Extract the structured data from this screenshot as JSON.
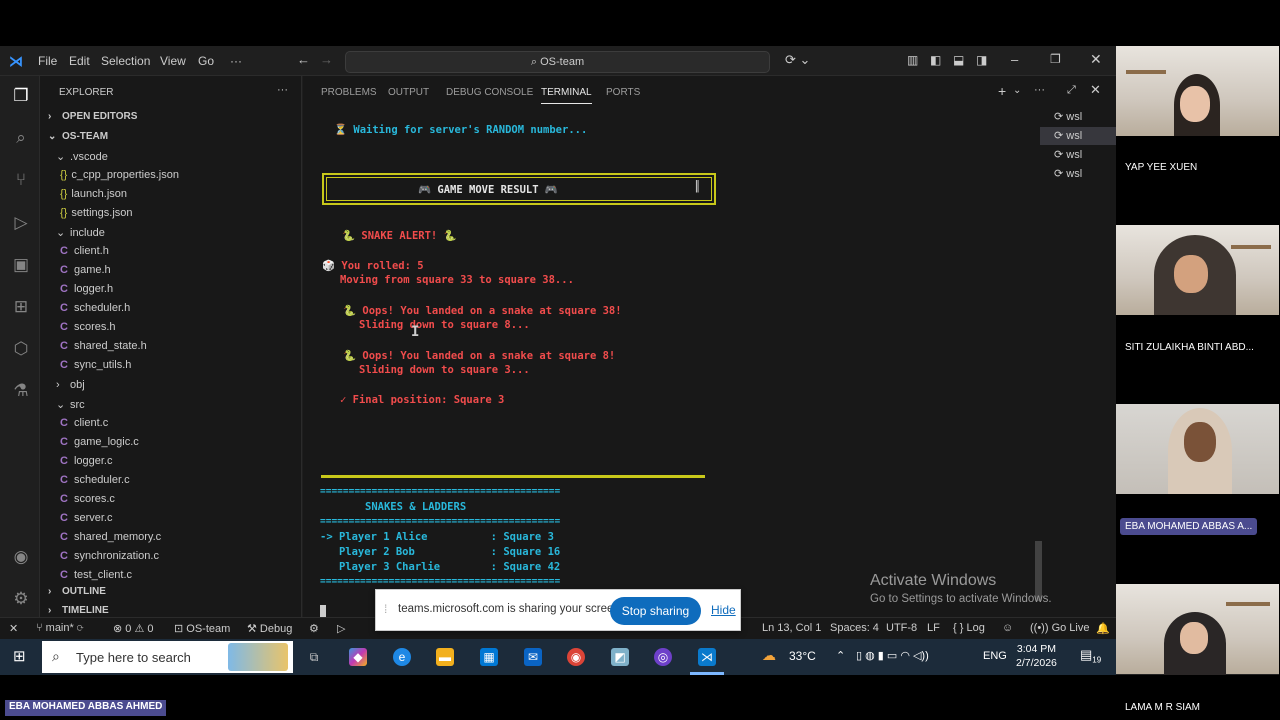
{
  "titlebar": {
    "menus": [
      "File",
      "Edit",
      "Selection",
      "View",
      "Go",
      "···"
    ],
    "search": "OS-team"
  },
  "explorer": {
    "header": "EXPLORER",
    "open_editors": "OPEN EDITORS",
    "root": "OS-TEAM",
    "vscode_folder": ".vscode",
    "vscode_files": [
      "c_cpp_properties.json",
      "launch.json",
      "settings.json"
    ],
    "include_folder": "include",
    "include_files": [
      "client.h",
      "game.h",
      "logger.h",
      "scheduler.h",
      "scores.h",
      "shared_state.h",
      "sync_utils.h"
    ],
    "obj_folder": "obj",
    "src_folder": "src",
    "src_files": [
      "client.c",
      "game_logic.c",
      "logger.c",
      "scheduler.c",
      "scores.c",
      "server.c",
      "shared_memory.c",
      "synchronization.c",
      "test_client.c"
    ],
    "outline": "OUTLINE",
    "timeline": "TIMELINE"
  },
  "panel": {
    "tabs": [
      "PROBLEMS",
      "OUTPUT",
      "DEBUG CONSOLE",
      "TERMINAL",
      "PORTS"
    ],
    "active_tab": "TERMINAL",
    "terminals": [
      "wsl",
      "wsl",
      "wsl",
      "wsl"
    ]
  },
  "terminal": {
    "waiting": "⏳ Waiting for server's RANDOM number...",
    "box_title": "🎮 GAME MOVE RESULT 🎮",
    "snake_alert": "🐍 SNAKE ALERT! 🐍",
    "rolled": "🎲 You rolled: 5",
    "moving": "Moving from square 33 to square 38...",
    "oops1": "🐍 Oops! You landed on a snake at square 38!",
    "slide1": "Sliding down to square 8...",
    "oops2": "🐍 Oops! You landed on a snake at square 8!",
    "slide2": "Sliding down to square 3...",
    "final": "✓ Final position: Square 3",
    "sep": "==========================================",
    "board_title": "SNAKES & LADDERS",
    "players": [
      "-> Player 1 Alice          : Square 3",
      "   Player 2 Bob            : Square 16",
      "   Player 3 Charlie        : Square 42"
    ]
  },
  "statusbar": {
    "branch": "main*",
    "errors": "⊗ 0  ⚠ 0",
    "project": "OS-team",
    "debug": "Debug",
    "cursor": "Ln 13, Col 1",
    "spaces": "Spaces: 4",
    "encoding": "UTF-8",
    "eol": "LF",
    "lang": "{ } Log",
    "golive": "Go Live"
  },
  "share_bar": {
    "message": "teams.microsoft.com is sharing your screen.",
    "stop": "Stop sharing",
    "hide": "Hide"
  },
  "watermark": {
    "line1": "Activate Windows",
    "line2": "Go to Settings to activate Windows."
  },
  "taskbar": {
    "search_placeholder": "Type here to search",
    "weather": "33°C",
    "lang": "ENG",
    "time": "3:04 PM",
    "date": "2/7/2026",
    "notif_count": "19"
  },
  "participants": [
    "YAP YEE XUEN",
    "SITI ZULAIKHA BINTI ABD...",
    "EBA MOHAMED ABBAS A...",
    "LAMA M R SIAM"
  ],
  "presenter_label": "EBA MOHAMED ABBAS AHMED"
}
